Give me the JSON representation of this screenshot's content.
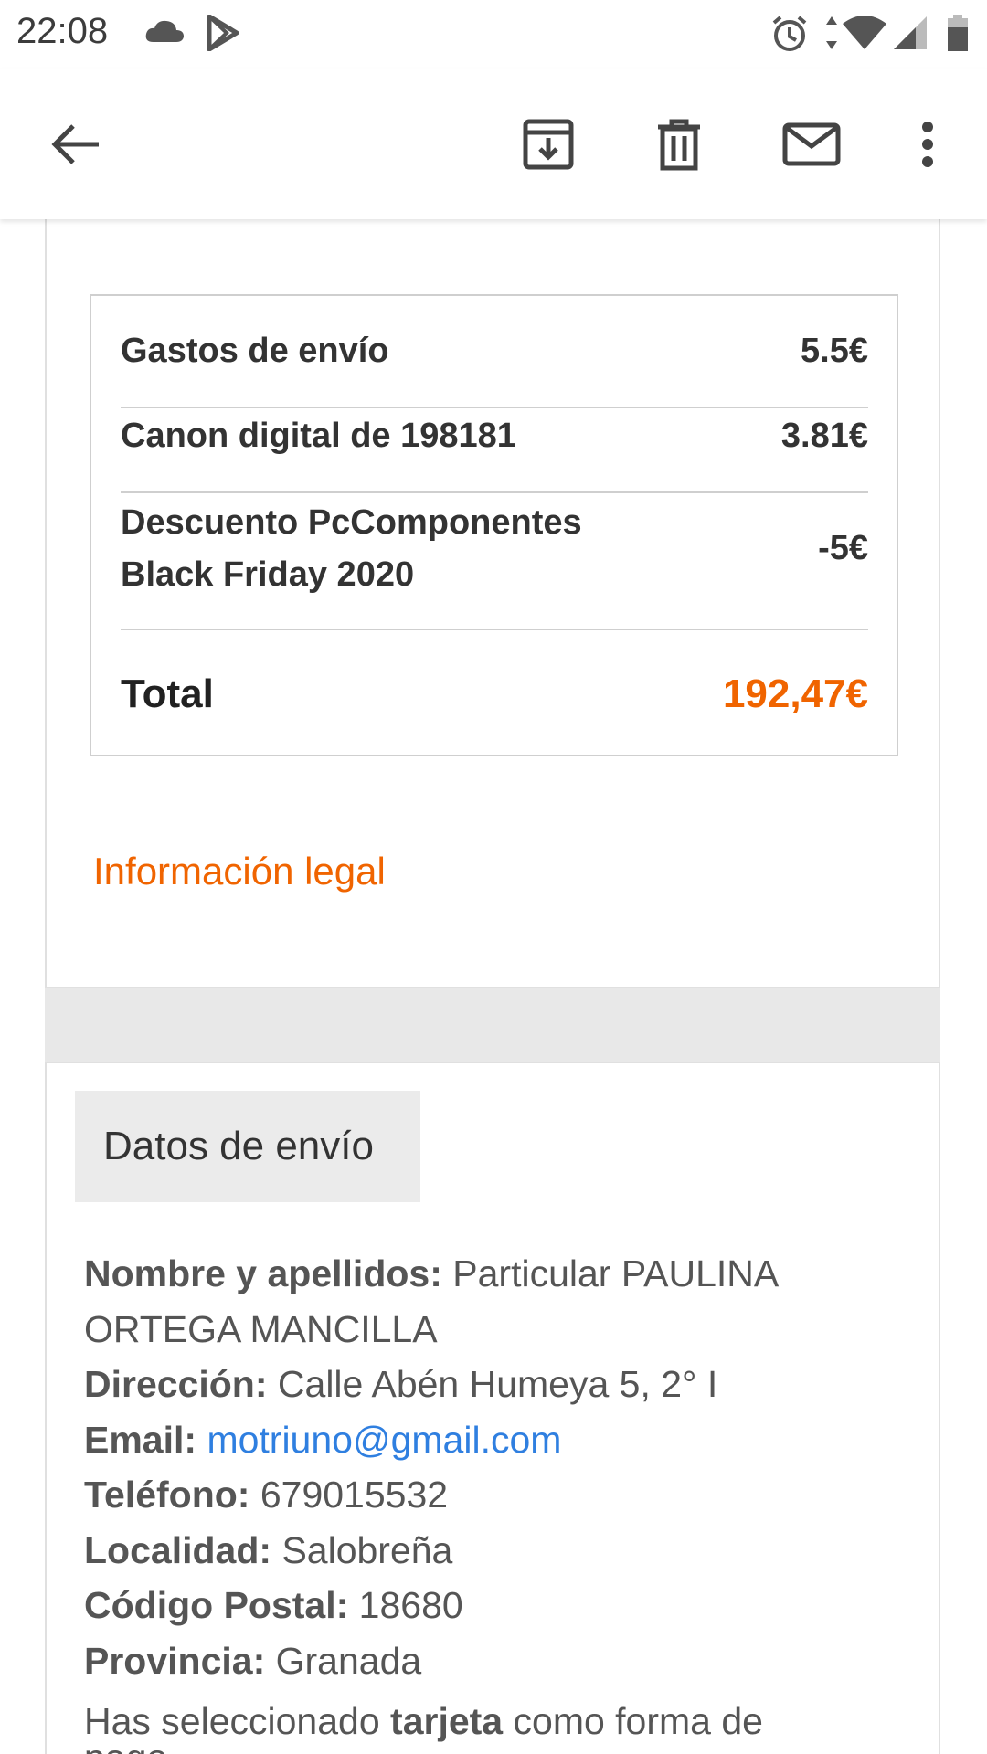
{
  "status_bar": {
    "time": "22:08",
    "left_icons": [
      "cloud-icon",
      "play-store-icon"
    ],
    "right_icons": [
      "alarm-icon",
      "data-arrows-icon",
      "wifi-icon",
      "signal-icon",
      "battery-icon"
    ]
  },
  "toolbar": {
    "icons": [
      "back-arrow-icon",
      "archive-icon",
      "delete-icon",
      "mark-unread-icon",
      "more-vert-icon"
    ]
  },
  "summary": {
    "rows": [
      {
        "label": "Gastos de envío",
        "value": "5.5€"
      },
      {
        "label": "Canon digital de 198181",
        "value": "3.81€"
      },
      {
        "label_line1": "Descuento PcComponentes",
        "label_line2": "Black Friday 2020",
        "value": "-5€"
      }
    ],
    "total_label": "Total",
    "total_value": "192,47€"
  },
  "legal_link": "Información legal",
  "shipping": {
    "title": "Datos de envío",
    "name_label": "Nombre y apellidos:",
    "name_value_line1": "Particular PAULINA",
    "name_value_line2": "ORTEGA MANCILLA",
    "address_label": "Dirección:",
    "address_value": "Calle Abén Humeya 5, 2° I",
    "email_label": "Email:",
    "email_value": "motriuno@gmail.com",
    "phone_label": "Teléfono:",
    "phone_value": "679015532",
    "city_label": "Localidad:",
    "city_value": "Salobreña",
    "zip_label": "Código Postal:",
    "zip_value": "18680",
    "province_label": "Provincia:",
    "province_value": "Granada"
  },
  "payment": {
    "prefix": "Has seleccionado",
    "method": "tarjeta",
    "suffix": "como forma de",
    "line2": "pago."
  },
  "colors": {
    "accent_orange": "#f06400",
    "link_blue": "#2f7fe0",
    "text_dark": "#333333",
    "text_gray": "#555555"
  }
}
